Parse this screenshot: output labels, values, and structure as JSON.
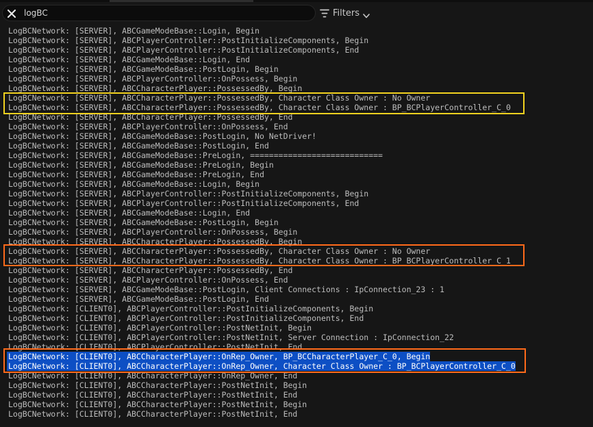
{
  "search": {
    "value": "logBC",
    "clear_icon": "close-icon"
  },
  "filters": {
    "label": "Filters",
    "icon": "filter-icon",
    "chevron": "chevron-down-icon"
  },
  "colors": {
    "selection": "#0d4fc4",
    "highlight_yellow": "#f2d21f",
    "highlight_orange": "#ff6a1a",
    "text": "#bdbdbd",
    "background": "#161616"
  },
  "log": {
    "lines": [
      "LogBCNetwork: [SERVER], ABCGameModeBase::Login, Begin",
      "LogBCNetwork: [SERVER], ABCPlayerController::PostInitializeComponents, Begin",
      "LogBCNetwork: [SERVER], ABCPlayerController::PostInitializeComponents, End",
      "LogBCNetwork: [SERVER], ABCGameModeBase::Login, End",
      "LogBCNetwork: [SERVER], ABCGameModeBase::PostLogin, Begin",
      "LogBCNetwork: [SERVER], ABCPlayerController::OnPossess, Begin",
      "LogBCNetwork: [SERVER], ABCCharacterPlayer::PossessedBy, Begin",
      "LogBCNetwork: [SERVER], ABCCharacterPlayer::PossessedBy, Character Class Owner : No Owner",
      "LogBCNetwork: [SERVER], ABCCharacterPlayer::PossessedBy, Character Class Owner : BP_BCPlayerController_C_0",
      "LogBCNetwork: [SERVER], ABCCharacterPlayer::PossessedBy, End",
      "LogBCNetwork: [SERVER], ABCPlayerController::OnPossess, End",
      "LogBCNetwork: [SERVER], ABCGameModeBase::PostLogin, No NetDriver!",
      "LogBCNetwork: [SERVER], ABCGameModeBase::PostLogin, End",
      "LogBCNetwork: [SERVER], ABCGameModeBase::PreLogin, ============================",
      "LogBCNetwork: [SERVER], ABCGameModeBase::PreLogin, Begin",
      "LogBCNetwork: [SERVER], ABCGameModeBase::PreLogin, End",
      "LogBCNetwork: [SERVER], ABCGameModeBase::Login, Begin",
      "LogBCNetwork: [SERVER], ABCPlayerController::PostInitializeComponents, Begin",
      "LogBCNetwork: [SERVER], ABCPlayerController::PostInitializeComponents, End",
      "LogBCNetwork: [SERVER], ABCGameModeBase::Login, End",
      "LogBCNetwork: [SERVER], ABCGameModeBase::PostLogin, Begin",
      "LogBCNetwork: [SERVER], ABCPlayerController::OnPossess, Begin",
      "LogBCNetwork: [SERVER], ABCCharacterPlayer::PossessedBy, Begin",
      "LogBCNetwork: [SERVER], ABCCharacterPlayer::PossessedBy, Character Class Owner : No Owner",
      "LogBCNetwork: [SERVER], ABCCharacterPlayer::PossessedBy, Character Class Owner : BP_BCPlayerController_C_1",
      "LogBCNetwork: [SERVER], ABCCharacterPlayer::PossessedBy, End",
      "LogBCNetwork: [SERVER], ABCPlayerController::OnPossess, End",
      "LogBCNetwork: [SERVER], ABCGameModeBase::PostLogin, Client Connections : IpConnection_23 : 1",
      "LogBCNetwork: [SERVER], ABCGameModeBase::PostLogin, End",
      "LogBCNetwork: [CLIENT0], ABCPlayerController::PostInitializeComponents, Begin",
      "LogBCNetwork: [CLIENT0], ABCPlayerController::PostInitializeComponents, End",
      "LogBCNetwork: [CLIENT0], ABCPlayerController::PostNetInit, Begin",
      "LogBCNetwork: [CLIENT0], ABCPlayerController::PostNetInit, Server Connection : IpConnection_22",
      "LogBCNetwork: [CLIENT0], ABCPlayerController::PostNetInit, End",
      "LogBCNetwork: [CLIENT0], ABCCharacterPlayer::OnRep_Owner, BP_BCCharacterPlayer_C_0, Begin",
      "LogBCNetwork: [CLIENT0], ABCCharacterPlayer::OnRep_Owner, Character Class Owner : BP_BCPlayerController_C_0",
      "LogBCNetwork: [CLIENT0], ABCCharacterPlayer::OnRep_Owner, End",
      "LogBCNetwork: [CLIENT0], ABCCharacterPlayer::PostNetInit, Begin",
      "LogBCNetwork: [CLIENT0], ABCCharacterPlayer::PostNetInit, End",
      "LogBCNetwork: [CLIENT0], ABCCharacterPlayer::PostNetInit, Begin",
      "LogBCNetwork: [CLIENT0], ABCCharacterPlayer::PostNetInit, End"
    ],
    "selected_lines": [
      34,
      35
    ]
  }
}
